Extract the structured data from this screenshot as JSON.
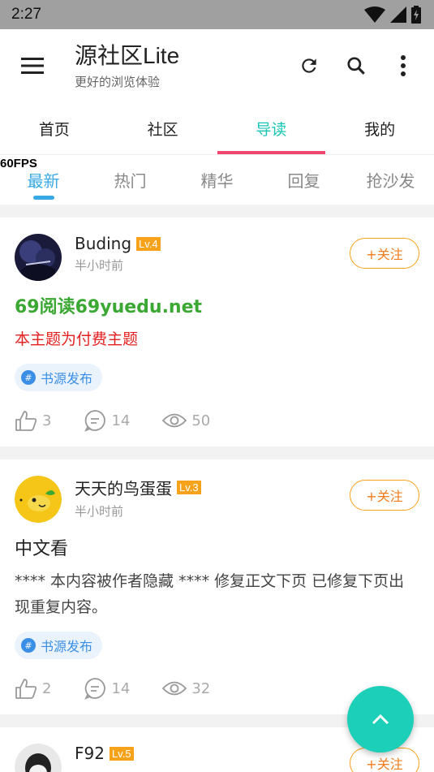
{
  "status": {
    "time": "2:27"
  },
  "app": {
    "title": "源社区Lite",
    "subtitle": "更好的浏览体验"
  },
  "main_tabs": [
    "首页",
    "社区",
    "导读",
    "我的"
  ],
  "sub_tabs": [
    "最新",
    "热门",
    "精华",
    "回复",
    "抢沙发"
  ],
  "fps": "60FPS",
  "follow_label": "+关注",
  "posts": [
    {
      "author": "Buding",
      "level": "Lv.4",
      "time": "半小时前",
      "title": "69阅读69yuedu.net",
      "excerpt": "本主题为付费主题",
      "tag": "书源发布",
      "likes": "3",
      "comments": "14",
      "views": "50"
    },
    {
      "author": "天天的鸟蛋蛋",
      "level": "Lv.3",
      "time": "半小时前",
      "title": "中文看",
      "excerpt": "**** 本内容被作者隐藏 **** 修复正文下页 已修复下页出现重复内容。",
      "tag": "书源发布",
      "likes": "2",
      "comments": "14",
      "views": "32"
    },
    {
      "author": "F92",
      "level": "Lv.5"
    }
  ],
  "colors": {
    "accent": "#18c6b6",
    "indicator": "#f0466f",
    "level": "#f7a21b",
    "fab": "#1ccfb9"
  }
}
